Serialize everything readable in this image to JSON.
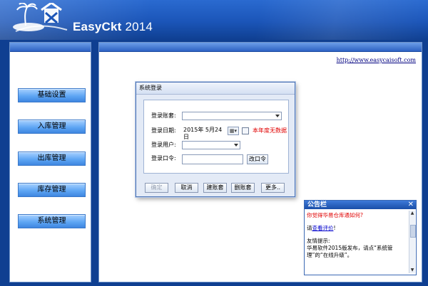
{
  "app": {
    "title_main": "EasyCkt",
    "title_year": "2014"
  },
  "website_url": "http://www.easycaisoft.com",
  "sidebar": {
    "items": [
      {
        "label": "基础设置"
      },
      {
        "label": "入库管理"
      },
      {
        "label": "出库管理"
      },
      {
        "label": "库存管理"
      },
      {
        "label": "系统管理"
      }
    ]
  },
  "login_dialog": {
    "title": "系统登录",
    "account_label": "登录账套:",
    "account_value": "",
    "date_label": "登录日期:",
    "date_value": "2015年 5月24日",
    "date_picker_glyph": "▦▾",
    "checkbox_checked": false,
    "no_data_notice": "本年度无数据",
    "user_label": "登录用户:",
    "user_value": "",
    "password_label": "登录口令:",
    "password_value": "",
    "change_password_label": "改口令",
    "buttons": {
      "ok": "确定",
      "cancel": "取消",
      "create_account": "建账套",
      "delete_account": "删账套",
      "more": "更多.."
    }
  },
  "notice_panel": {
    "title": "公告栏",
    "close_glyph": "✕",
    "question": "你觉得华易仓库通如何?",
    "please_prefix": "请",
    "rate_link": "查看评价",
    "please_suffix": "!",
    "tip_heading": "友情提示:",
    "tip_text": "华易软件2015版发布，请点“系统管理”的“在线升级”。"
  },
  "colors": {
    "background": "#0f3f91",
    "panel_border": "#6f93c9",
    "nav_button": "#5fa6f4",
    "warning_red": "#e00000",
    "link_blue": "#0000cc"
  }
}
